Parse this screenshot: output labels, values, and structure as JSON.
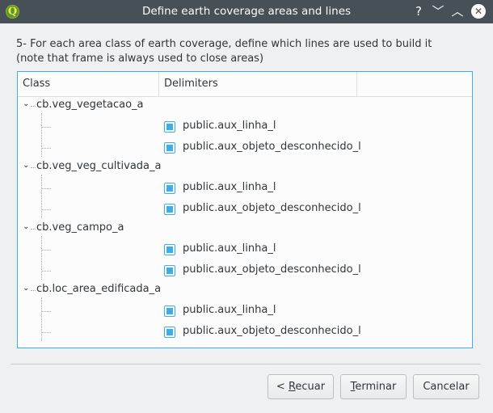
{
  "window": {
    "title": "Define earth coverage areas and lines",
    "controls": [
      "?",
      "﹀",
      "︿",
      "✕"
    ]
  },
  "instructions": {
    "line1": "5- For each area class of earth coverage, define which lines are used to build it",
    "line2": "(note that frame is always used to close areas)"
  },
  "tree": {
    "headers": [
      "Class",
      "Delimiters",
      ""
    ],
    "classes": [
      {
        "name": "cb.veg_vegetacao_a",
        "delimiters": [
          {
            "label": "public.aux_linha_l",
            "checked": true
          },
          {
            "label": "public.aux_objeto_desconhecido_l",
            "checked": true
          }
        ]
      },
      {
        "name": "cb.veg_veg_cultivada_a",
        "delimiters": [
          {
            "label": "public.aux_linha_l",
            "checked": true
          },
          {
            "label": "public.aux_objeto_desconhecido_l",
            "checked": true
          }
        ]
      },
      {
        "name": "cb.veg_campo_a",
        "delimiters": [
          {
            "label": "public.aux_linha_l",
            "checked": true
          },
          {
            "label": "public.aux_objeto_desconhecido_l",
            "checked": true
          }
        ]
      },
      {
        "name": "cb.loc_area_edificada_a",
        "delimiters": [
          {
            "label": "public.aux_linha_l",
            "checked": true
          },
          {
            "label": "public.aux_objeto_desconhecido_l",
            "checked": true
          }
        ]
      }
    ]
  },
  "buttons": {
    "back_prefix": "< ",
    "back_mnemonic": "R",
    "back_rest": "ecuar",
    "finish_mnemonic": "T",
    "finish_rest": "erminar",
    "cancel": "Cancelar"
  },
  "colors": {
    "accent": "#3daee9",
    "titlebar": "#475057"
  }
}
